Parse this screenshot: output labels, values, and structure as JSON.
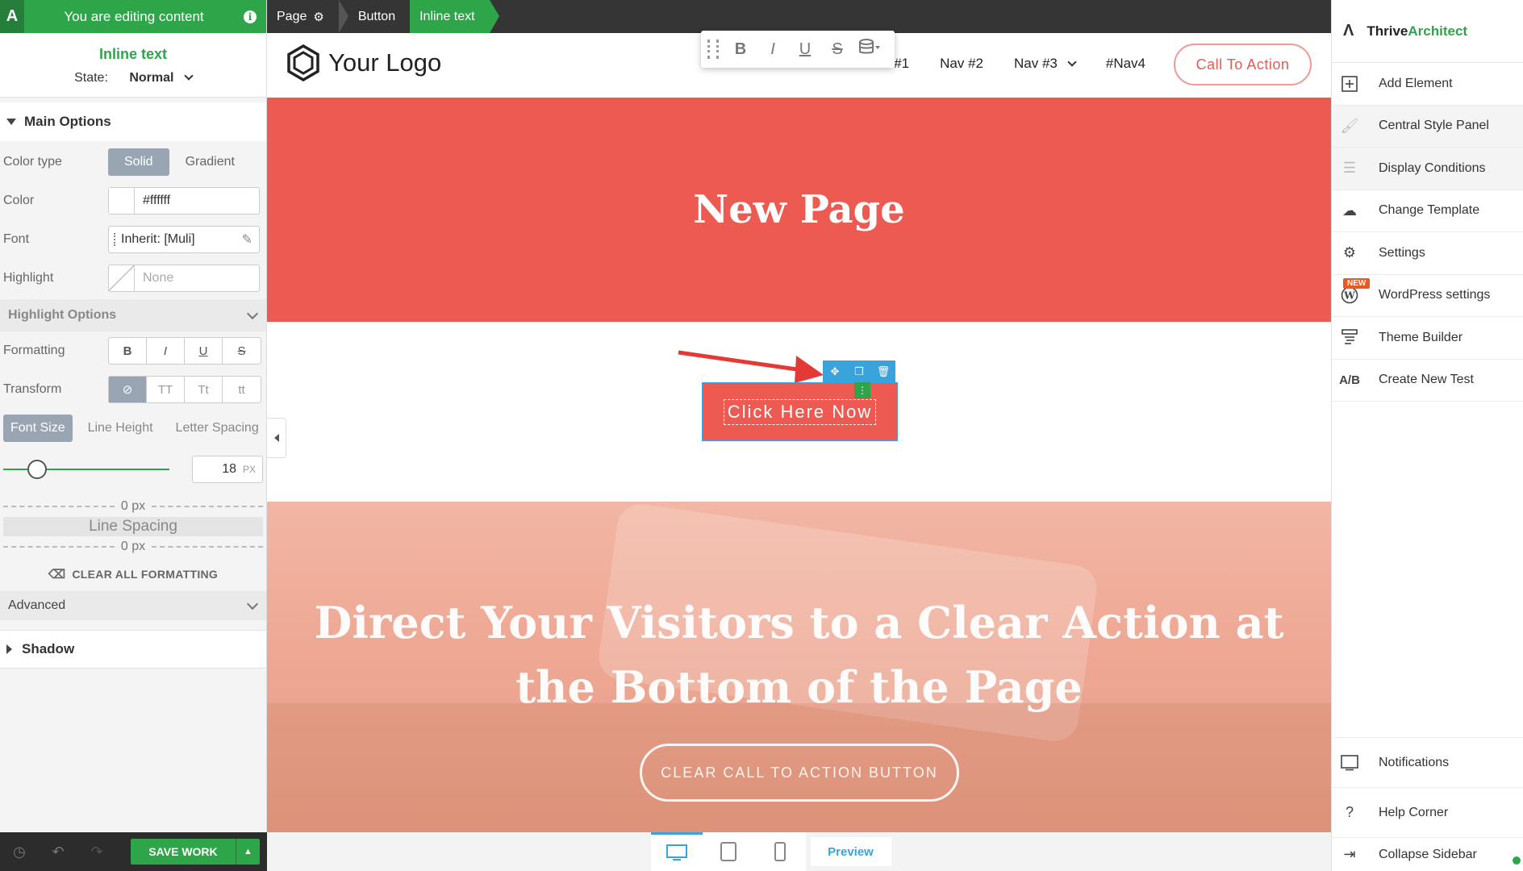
{
  "left_panel": {
    "editing_banner": "You are editing content",
    "title": "Inline text",
    "state_label": "State:",
    "state_value": "Normal",
    "main_options": "Main Options",
    "color_type_label": "Color type",
    "color_type_options": [
      "Solid",
      "Gradient"
    ],
    "color_label": "Color",
    "color_value": "#ffffff",
    "font_label": "Font",
    "font_value": "Inherit: [Muli]",
    "highlight_label": "Highlight",
    "highlight_value": "None",
    "highlight_options": "Highlight Options",
    "formatting_label": "Formatting",
    "formatting_buttons": [
      "B",
      "I",
      "U",
      "S"
    ],
    "transform_label": "Transform",
    "transform_buttons": [
      "⊘",
      "TT",
      "Tt",
      "tt"
    ],
    "size_tabs": [
      "Font Size",
      "Line Height",
      "Letter Spacing"
    ],
    "font_size_value": "18",
    "font_size_unit": "PX",
    "spacing_top": "0 px",
    "line_spacing_label": "Line Spacing",
    "spacing_bottom": "0 px",
    "clear_formatting": "CLEAR ALL FORMATTING",
    "advanced": "Advanced",
    "shadow": "Shadow",
    "save_label": "SAVE WORK"
  },
  "breadcrumb": [
    "Page",
    "Button",
    "Inline text"
  ],
  "site": {
    "logo_text": "Your Logo",
    "nav": [
      "Nav #1",
      "Nav #2",
      "Nav #3",
      "#Nav4"
    ],
    "cta": "Call To Action",
    "hero_title": "New Page",
    "button_text": "Click Here Now",
    "section_title": "Direct Your Visitors to a Clear Action at the Bottom of the Page",
    "section_cta": "CLEAR CALL TO ACTION BUTTON",
    "preview": "Preview"
  },
  "toolbar": [
    "B",
    "I",
    "U",
    "S"
  ],
  "right_panel": {
    "brand_a": "Thrive",
    "brand_b": "Architect",
    "items": [
      "Add Element",
      "Central Style Panel",
      "Display Conditions",
      "Change Template",
      "Settings",
      "WordPress settings",
      "Theme Builder",
      "Create New Test"
    ],
    "new_badge": "NEW",
    "bottom_items": [
      "Notifications",
      "Help Corner",
      "Collapse Sidebar"
    ]
  },
  "colors": {
    "brand_green": "#2fa54a",
    "hero_red": "#ed5a51",
    "selection_blue": "#3aa3dc"
  }
}
